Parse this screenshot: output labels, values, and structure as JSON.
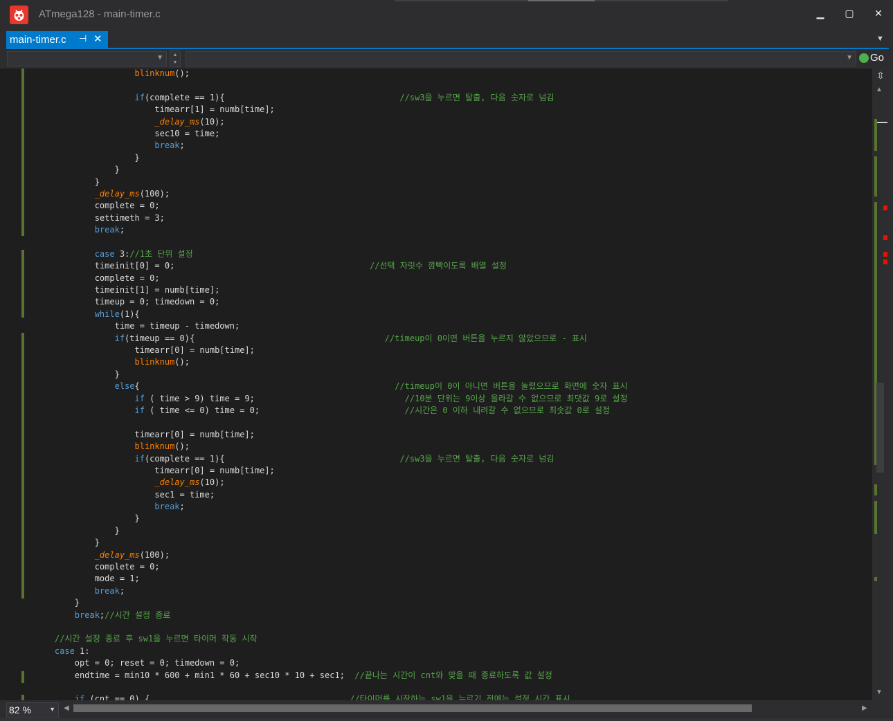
{
  "window": {
    "title": "ATmega128 - main-timer.c",
    "app_icon": "atmel-studio-bug-icon",
    "minimize_glyph": "▁",
    "maximize_glyph": "▢",
    "close_glyph": "✕"
  },
  "tab": {
    "label": "main-timer.c",
    "pin_glyph": "⊣",
    "close_glyph": "✕",
    "overflow_glyph": "▼"
  },
  "navbar": {
    "scope_value": "",
    "member_value": "",
    "go_label": "Go"
  },
  "colors": {
    "keyword": "#569cd6",
    "function": "#ff8000",
    "comment": "#57a64a",
    "tab_accent": "#007acc",
    "change_bar": "#577430",
    "error_mark": "#e51400"
  },
  "editor": {
    "lines": [
      [
        [
          "plain",
          "                    "
        ],
        [
          "func",
          "blinknum"
        ],
        [
          "plain",
          "();"
        ]
      ],
      [
        [
          "plain",
          ""
        ]
      ],
      [
        [
          "plain",
          "                    "
        ],
        [
          "kw",
          "if"
        ],
        [
          "plain",
          "(complete == 1){                                   "
        ],
        [
          "cm",
          "//sw3을 누르면 탈출, 다음 숫자로 넘김"
        ]
      ],
      [
        [
          "plain",
          "                        timearr[1] = numb[time];"
        ]
      ],
      [
        [
          "plain",
          "                        "
        ],
        [
          "macro",
          "_delay_ms"
        ],
        [
          "plain",
          "(10);"
        ]
      ],
      [
        [
          "plain",
          "                        sec10 = time;"
        ]
      ],
      [
        [
          "plain",
          "                        "
        ],
        [
          "kw",
          "break"
        ],
        [
          "plain",
          ";"
        ]
      ],
      [
        [
          "plain",
          "                    }"
        ]
      ],
      [
        [
          "plain",
          "                }"
        ]
      ],
      [
        [
          "plain",
          "            }"
        ]
      ],
      [
        [
          "plain",
          "            "
        ],
        [
          "macro",
          "_delay_ms"
        ],
        [
          "plain",
          "(100);"
        ]
      ],
      [
        [
          "plain",
          "            complete = 0;"
        ]
      ],
      [
        [
          "plain",
          "            settimeth = 3;"
        ]
      ],
      [
        [
          "plain",
          "            "
        ],
        [
          "kw",
          "break"
        ],
        [
          "plain",
          ";"
        ]
      ],
      [
        [
          "plain",
          ""
        ]
      ],
      [
        [
          "plain",
          "            "
        ],
        [
          "kw",
          "case"
        ],
        [
          "plain",
          " 3:"
        ],
        [
          "cm",
          "//1초 단위 설정"
        ]
      ],
      [
        [
          "plain",
          "            timeinit[0] = 0;                                       "
        ],
        [
          "cm",
          "//선택 자릿수 깜빡이도록 배열 설정"
        ]
      ],
      [
        [
          "plain",
          "            complete = 0;"
        ]
      ],
      [
        [
          "plain",
          "            timeinit[1] = numb[time];"
        ]
      ],
      [
        [
          "plain",
          "            timeup = 0; timedown = 0;"
        ]
      ],
      [
        [
          "plain",
          "            "
        ],
        [
          "kw",
          "while"
        ],
        [
          "plain",
          "(1){"
        ]
      ],
      [
        [
          "plain",
          "                time = timeup - timedown;"
        ]
      ],
      [
        [
          "plain",
          "                "
        ],
        [
          "kw",
          "if"
        ],
        [
          "plain",
          "(timeup == 0){                                      "
        ],
        [
          "cm",
          "//timeup이 0이면 버튼을 누르지 않았으므로 - 표시"
        ]
      ],
      [
        [
          "plain",
          "                    timearr[0] = numb[time];"
        ]
      ],
      [
        [
          "plain",
          "                    "
        ],
        [
          "func",
          "blinknum"
        ],
        [
          "plain",
          "();"
        ]
      ],
      [
        [
          "plain",
          "                }"
        ]
      ],
      [
        [
          "plain",
          "                "
        ],
        [
          "kw",
          "else"
        ],
        [
          "plain",
          "{                                                   "
        ],
        [
          "cm",
          "//timeup이 0이 아니면 버튼을 눌렀으므로 화면에 숫자 표시"
        ]
      ],
      [
        [
          "plain",
          "                    "
        ],
        [
          "kw",
          "if"
        ],
        [
          "plain",
          " ( time > 9) time = 9;                              "
        ],
        [
          "cm",
          "//10분 단위는 9이상 올라갈 수 없으므로 최댓값 9로 설정"
        ]
      ],
      [
        [
          "plain",
          "                    "
        ],
        [
          "kw",
          "if"
        ],
        [
          "plain",
          " ( time <= 0) time = 0;                             "
        ],
        [
          "cm",
          "//시간은 0 이하 내려갈 수 없으므로 최솟값 0로 설정"
        ]
      ],
      [
        [
          "plain",
          ""
        ]
      ],
      [
        [
          "plain",
          "                    timearr[0] = numb[time];"
        ]
      ],
      [
        [
          "plain",
          "                    "
        ],
        [
          "func",
          "blinknum"
        ],
        [
          "plain",
          "();"
        ]
      ],
      [
        [
          "plain",
          "                    "
        ],
        [
          "kw",
          "if"
        ],
        [
          "plain",
          "(complete == 1){                                   "
        ],
        [
          "cm",
          "//sw3을 누르면 탈출, 다음 숫자로 넘김"
        ]
      ],
      [
        [
          "plain",
          "                        timearr[0] = numb[time];"
        ]
      ],
      [
        [
          "plain",
          "                        "
        ],
        [
          "macro",
          "_delay_ms"
        ],
        [
          "plain",
          "(10);"
        ]
      ],
      [
        [
          "plain",
          "                        sec1 = time;"
        ]
      ],
      [
        [
          "plain",
          "                        "
        ],
        [
          "kw",
          "break"
        ],
        [
          "plain",
          ";"
        ]
      ],
      [
        [
          "plain",
          "                    }"
        ]
      ],
      [
        [
          "plain",
          "                }"
        ]
      ],
      [
        [
          "plain",
          "            }"
        ]
      ],
      [
        [
          "plain",
          "            "
        ],
        [
          "macro",
          "_delay_ms"
        ],
        [
          "plain",
          "(100);"
        ]
      ],
      [
        [
          "plain",
          "            complete = 0;"
        ]
      ],
      [
        [
          "plain",
          "            mode = 1;"
        ]
      ],
      [
        [
          "plain",
          "            "
        ],
        [
          "kw",
          "break"
        ],
        [
          "plain",
          ";"
        ]
      ],
      [
        [
          "plain",
          "        }"
        ]
      ],
      [
        [
          "plain",
          "        "
        ],
        [
          "kw",
          "break"
        ],
        [
          "plain",
          ";"
        ],
        [
          "cm",
          "//시간 설정 종료"
        ]
      ],
      [
        [
          "plain",
          ""
        ]
      ],
      [
        [
          "plain",
          "    "
        ],
        [
          "cm",
          "//시간 설정 종료 후 sw1을 누르면 타이머 작동 시작"
        ]
      ],
      [
        [
          "plain",
          "    "
        ],
        [
          "kw",
          "case"
        ],
        [
          "plain",
          " 1:"
        ]
      ],
      [
        [
          "plain",
          "        opt = 0; reset = 0; timedown = 0;"
        ]
      ],
      [
        [
          "plain",
          "        endtime = min10 * 600 + min1 * 60 + sec10 * 10 + sec1;  "
        ],
        [
          "cm",
          "//끝나는 시간이 cnt와 맞을 때 종료하도록 값 설정"
        ]
      ],
      [
        [
          "plain",
          ""
        ]
      ],
      [
        [
          "plain",
          "        "
        ],
        [
          "kw",
          "if"
        ],
        [
          "plain",
          " (cnt == 0) {                                        "
        ],
        [
          "cm",
          "//타이머를 시작하는 sw1을 누르기 전에는 설정 시간 표시"
        ]
      ]
    ]
  },
  "statusbar": {
    "zoom": "82 %"
  }
}
